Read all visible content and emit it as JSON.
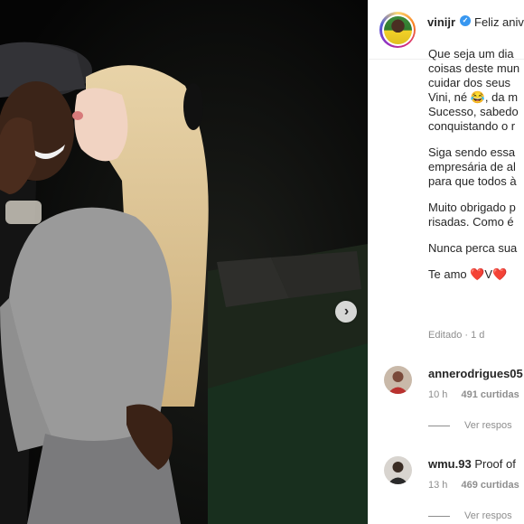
{
  "post": {
    "username": "vinijr",
    "verified_glyph": "✓",
    "caption_start": "Feliz aniv",
    "caption_lines": [
      "Que seja um dia",
      "coisas deste mun",
      "cuidar dos seus",
      "Vini, né 😂, da m",
      "Sucesso, sabedo",
      "conquistando o r",
      "",
      "Siga sendo essa",
      "empresária de al",
      "para que todos à",
      "",
      "Muito obrigado p",
      "risadas. Como é",
      "",
      "Nunca perca sua",
      "",
      "Te amo ❤️V❤️"
    ],
    "edited": "Editado · 1 d",
    "next_icon": "chevron-right-icon",
    "next_glyph": "›"
  },
  "comments": [
    {
      "username": "annerodrigues05",
      "text": "",
      "time": "10 h",
      "likes": "491 curtidas",
      "replies_label": "Ver respos"
    },
    {
      "username": "wmu.93",
      "text": "Proof of",
      "time": "13 h",
      "likes": "469 curtidas",
      "replies_label": "Ver respos"
    }
  ],
  "colors": {
    "verified": "#3897f0",
    "meta": "#8e8e8e",
    "heart": "#e0245e"
  }
}
